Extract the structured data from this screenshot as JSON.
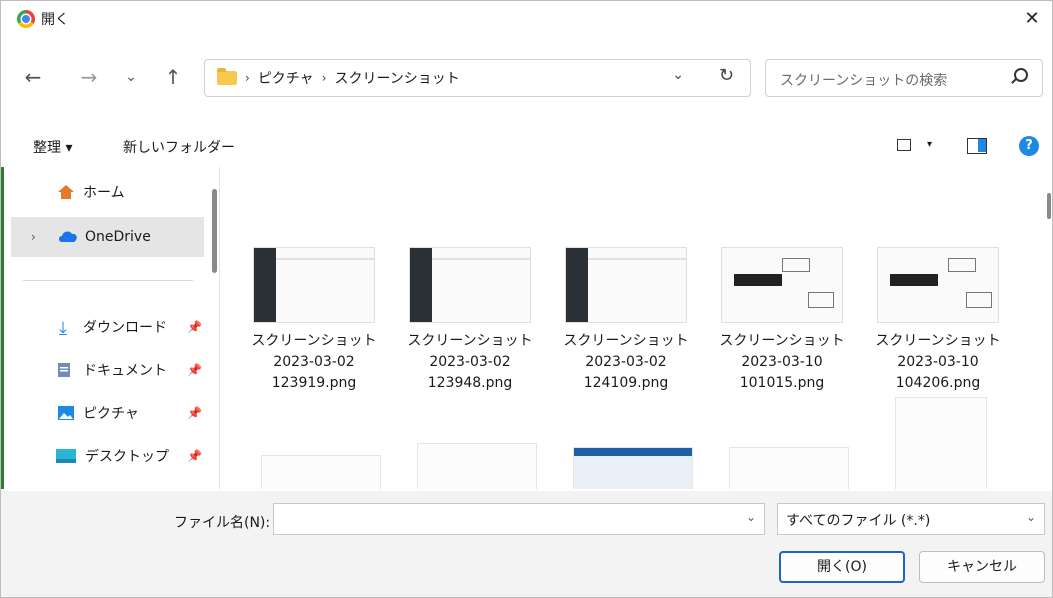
{
  "title": "開く",
  "breadcrumb": [
    "ピクチャ",
    "スクリーンショット"
  ],
  "search_placeholder": "スクリーンショットの検索",
  "commands": {
    "organize": "整理 ▾",
    "new_folder": "新しいフォルダー"
  },
  "sidebar": [
    {
      "label": "ホーム",
      "icon": "home-icon",
      "pinned": false
    },
    {
      "label": "OneDrive",
      "icon": "cloud-icon",
      "pinned": false,
      "selected": true
    },
    {
      "label": "ダウンロード",
      "icon": "download-icon",
      "pinned": true
    },
    {
      "label": "ドキュメント",
      "icon": "document-icon",
      "pinned": true
    },
    {
      "label": "ピクチャ",
      "icon": "picture-icon",
      "pinned": true
    },
    {
      "label": "デスクトップ",
      "icon": "desktop-icon",
      "pinned": true
    }
  ],
  "files": [
    {
      "name1": "スクリーンショット",
      "name2": "2023-03-02",
      "name3": "123919.png"
    },
    {
      "name1": "スクリーンショット",
      "name2": "2023-03-02",
      "name3": "123948.png"
    },
    {
      "name1": "スクリーンショット",
      "name2": "2023-03-02",
      "name3": "124109.png"
    },
    {
      "name1": "スクリーンショット",
      "name2": "2023-03-10",
      "name3": "101015.png"
    },
    {
      "name1": "スクリーンショット",
      "name2": "2023-03-10",
      "name3": "104206.png"
    }
  ],
  "filename_label": "ファイル名(N):",
  "filename_value": "",
  "filetype": "すべてのファイル (*.*)",
  "open_button": "開く(O)",
  "cancel_button": "キャンセル"
}
